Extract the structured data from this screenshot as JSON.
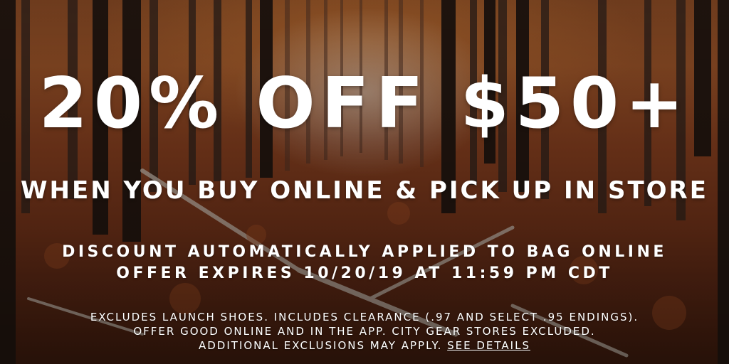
{
  "banner": {
    "headline": "20% OFF $50+",
    "subhead": "WHEN YOU BUY ONLINE & PICK UP IN STORE",
    "promo_line_1": "DISCOUNT AUTOMATICALLY APPLIED TO BAG ONLINE",
    "promo_line_2": "OFFER EXPIRES 10/20/19 AT 11:59 PM CDT",
    "fine_print_line_1": "EXCLUDES LAUNCH SHOES. INCLUDES CLEARANCE (.97 AND SELECT .95 ENDINGS).",
    "fine_print_line_2": "OFFER GOOD ONLINE AND IN THE APP. CITY GEAR STORES EXCLUDED.",
    "fine_print_line_3": "ADDITIONAL EXCLUSIONS MAY APPLY.",
    "details_link": "SEE DETAILS"
  },
  "colors": {
    "text": "#ffffff",
    "leaves": "#7b3a1c",
    "trunks": "#2a1a12"
  }
}
